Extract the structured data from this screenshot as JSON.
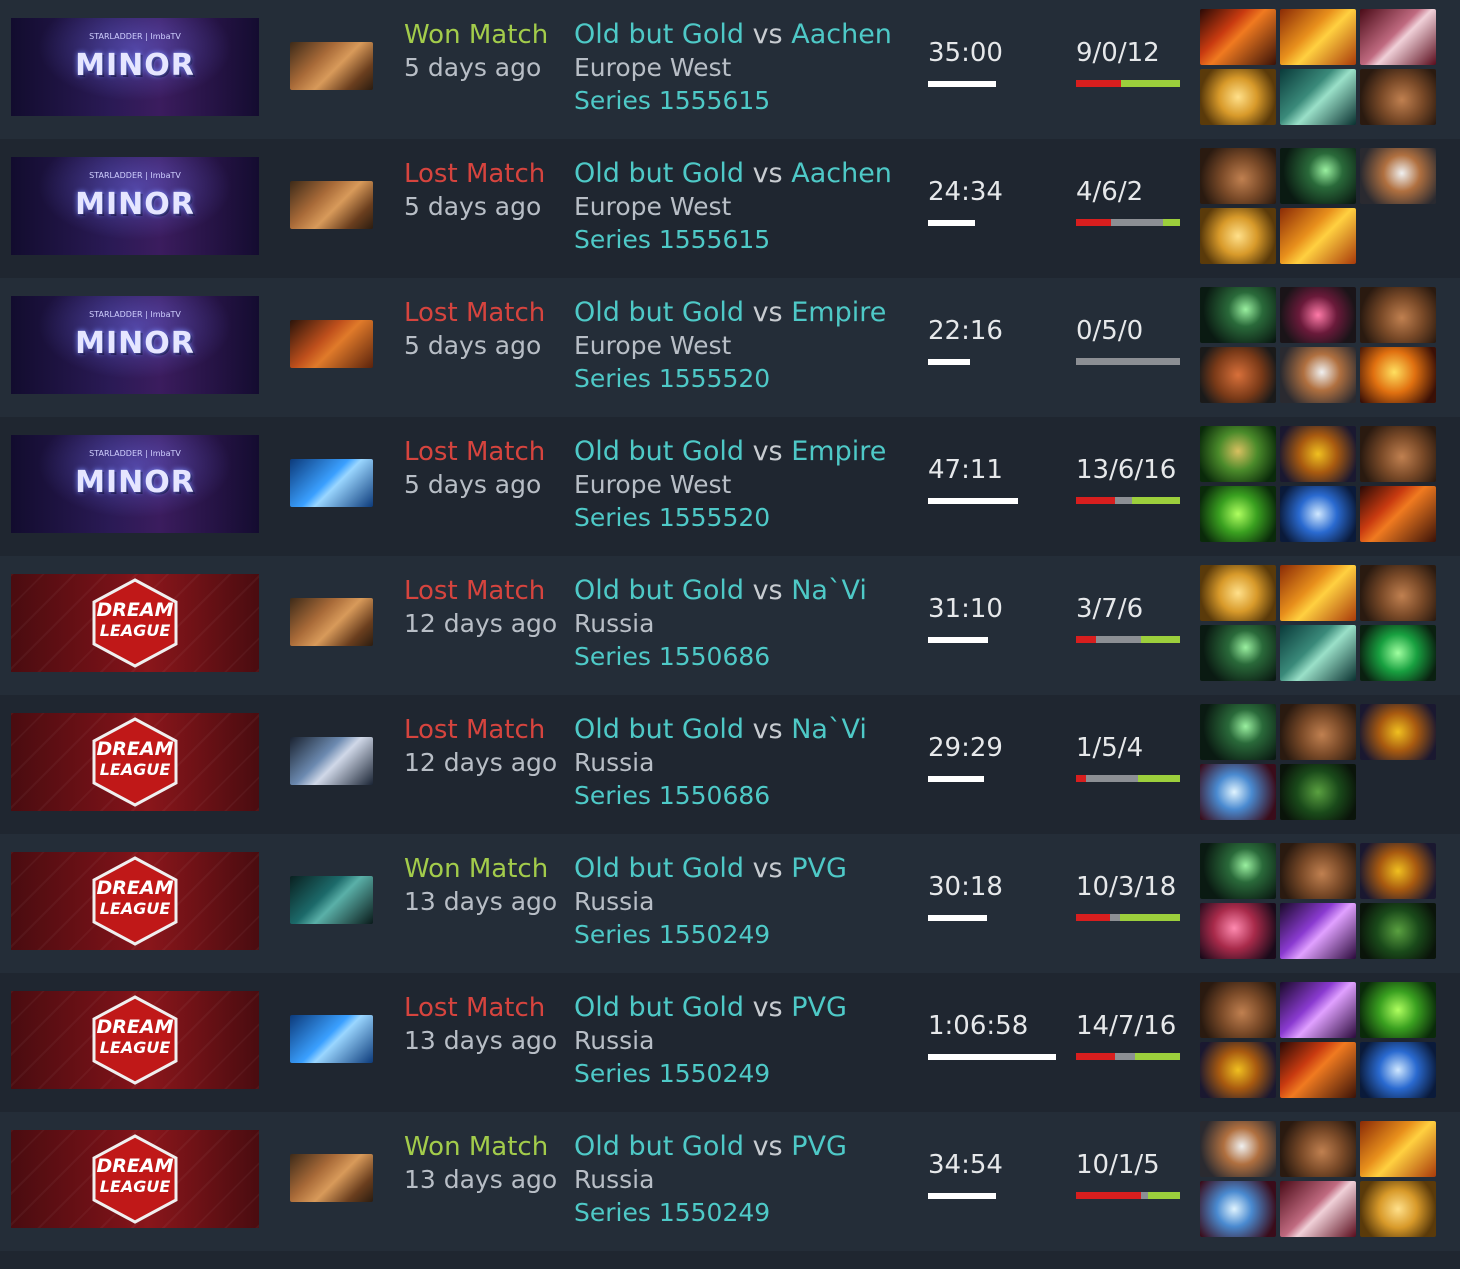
{
  "matches": [
    {
      "league": "minor",
      "league_logo": {
        "top": "STARLADDER | ImbaTV",
        "main": "MINOR"
      },
      "hero_icon": "troll-hero-icon",
      "hero_style": "h1",
      "result": "Won Match",
      "result_type": "won",
      "ago": "5 days ago",
      "team_a": "Old but Gold",
      "vs": "vs",
      "team_b": "Aachen",
      "region": "Europe West",
      "series": "Series 1555615",
      "duration": "35:00",
      "duration_fraction": 0.53,
      "kda": "9/0/12",
      "kda_parts": [
        9,
        0,
        12
      ],
      "items": [
        "armlet-icon",
        "desolator-icon",
        "hood-icon",
        "midas-icon",
        "armor-icon",
        "boots-icon"
      ]
    },
    {
      "league": "minor",
      "league_logo": {
        "top": "STARLADDER | ImbaTV",
        "main": "MINOR"
      },
      "hero_icon": "troll-hero-icon",
      "hero_style": "h1",
      "result": "Lost Match",
      "result_type": "lost",
      "ago": "5 days ago",
      "team_a": "Old but Gold",
      "vs": "vs",
      "team_b": "Aachen",
      "region": "Europe West",
      "series": "Series 1555615",
      "duration": "24:34",
      "duration_fraction": 0.37,
      "kda": "4/6/2",
      "kda_parts": [
        4,
        6,
        2
      ],
      "items": [
        "boots-icon",
        "wand-icon",
        "axe-icon",
        "midas-icon",
        "desolator-icon",
        ""
      ]
    },
    {
      "league": "minor",
      "league_logo": {
        "top": "STARLADDER | ImbaTV",
        "main": "MINOR"
      },
      "hero_icon": "chaos-hero-icon",
      "hero_style": "h2",
      "result": "Lost Match",
      "result_type": "lost",
      "ago": "5 days ago",
      "team_a": "Old but Gold",
      "vs": "vs",
      "team_b": "Empire",
      "region": "Europe West",
      "series": "Series 1555520",
      "duration": "22:16",
      "duration_fraction": 0.33,
      "kda": "0/5/0",
      "kda_parts": [
        0,
        5,
        0
      ],
      "items": [
        "wand-icon",
        "blade-icon",
        "boots-icon",
        "shield-icon",
        "axe-icon",
        "radiance-icon"
      ]
    },
    {
      "league": "minor",
      "league_logo": {
        "top": "STARLADDER | ImbaTV",
        "main": "MINOR"
      },
      "hero_icon": "storm-hero-icon",
      "hero_style": "h3",
      "result": "Lost Match",
      "result_type": "lost",
      "ago": "5 days ago",
      "team_a": "Old but Gold",
      "vs": "vs",
      "team_b": "Empire",
      "region": "Europe West",
      "series": "Series 1555520",
      "duration": "47:11",
      "duration_fraction": 0.7,
      "kda": "13/6/16",
      "kda_parts": [
        13,
        6,
        16
      ],
      "items": [
        "drum-icon",
        "helm-icon",
        "boots-icon",
        "orb-icon",
        "scepter-icon",
        "armlet-icon"
      ]
    },
    {
      "league": "dream",
      "league_logo": {
        "top": "DREAM",
        "main": "LEAGUE"
      },
      "hero_icon": "troll-hero-icon",
      "hero_style": "h1",
      "result": "Lost Match",
      "result_type": "lost",
      "ago": "12 days ago",
      "team_a": "Old but Gold",
      "vs": "vs",
      "team_b": "Na`Vi",
      "region": "Russia",
      "series": "Series 1550686",
      "duration": "31:10",
      "duration_fraction": 0.47,
      "kda": "3/7/6",
      "kda_parts": [
        3,
        7,
        6
      ],
      "items": [
        "midas-icon",
        "desolator-icon",
        "boots-icon",
        "wand-icon",
        "armor-icon",
        "ring-icon"
      ]
    },
    {
      "league": "dream",
      "league_logo": {
        "top": "DREAM",
        "main": "LEAGUE"
      },
      "hero_icon": "knight-hero-icon",
      "hero_style": "h4",
      "result": "Lost Match",
      "result_type": "lost",
      "ago": "12 days ago",
      "team_a": "Old but Gold",
      "vs": "vs",
      "team_b": "Na`Vi",
      "region": "Russia",
      "series": "Series 1550686",
      "duration": "29:29",
      "duration_fraction": 0.44,
      "kda": "1/5/4",
      "kda_parts": [
        1,
        5,
        4
      ],
      "items": [
        "wand-icon",
        "boots-icon",
        "helm-icon",
        "crystal-axe-icon",
        "mask-icon",
        ""
      ]
    },
    {
      "league": "dream",
      "league_logo": {
        "top": "DREAM",
        "main": "LEAGUE"
      },
      "hero_icon": "venom-hero-icon",
      "hero_style": "h5",
      "result": "Won Match",
      "result_type": "won",
      "ago": "13 days ago",
      "team_a": "Old but Gold",
      "vs": "vs",
      "team_b": "PVG",
      "region": "Russia",
      "series": "Series 1550249",
      "duration": "30:18",
      "duration_fraction": 0.46,
      "kda": "10/3/18",
      "kda_parts": [
        10,
        3,
        18
      ],
      "items": [
        "wand-icon",
        "boots-icon",
        "helm-icon",
        "heart-icon",
        "dagon-icon",
        "mask-icon"
      ]
    },
    {
      "league": "dream",
      "league_logo": {
        "top": "DREAM",
        "main": "LEAGUE"
      },
      "hero_icon": "storm-hero-icon",
      "hero_style": "h3",
      "result": "Lost Match",
      "result_type": "lost",
      "ago": "13 days ago",
      "team_a": "Old but Gold",
      "vs": "vs",
      "team_b": "PVG",
      "region": "Russia",
      "series": "Series 1550249",
      "duration": "1:06:58",
      "duration_fraction": 1.0,
      "kda": "14/7/16",
      "kda_parts": [
        14,
        7,
        16
      ],
      "items": [
        "boots-icon",
        "dagon-icon",
        "orb-icon",
        "helm-icon",
        "armlet-icon",
        "scepter-icon"
      ]
    },
    {
      "league": "dream",
      "league_logo": {
        "top": "DREAM",
        "main": "LEAGUE"
      },
      "hero_icon": "troll-hero-icon",
      "hero_style": "h1",
      "result": "Won Match",
      "result_type": "won",
      "ago": "13 days ago",
      "team_a": "Old but Gold",
      "vs": "vs",
      "team_b": "PVG",
      "region": "Russia",
      "series": "Series 1550249",
      "duration": "34:54",
      "duration_fraction": 0.53,
      "kda": "10/1/5",
      "kda_parts": [
        10,
        1,
        5
      ],
      "items": [
        "axe-icon",
        "boots-icon",
        "desolator-icon",
        "crystal-axe-icon",
        "hood-icon",
        "midas-icon"
      ]
    }
  ],
  "colors": {
    "won": "#a3cc4b",
    "lost": "#d6443e",
    "link": "#4ec9c7",
    "kill": "#d81e1e",
    "death": "#8c8f94",
    "assist": "#9ccf3c"
  }
}
